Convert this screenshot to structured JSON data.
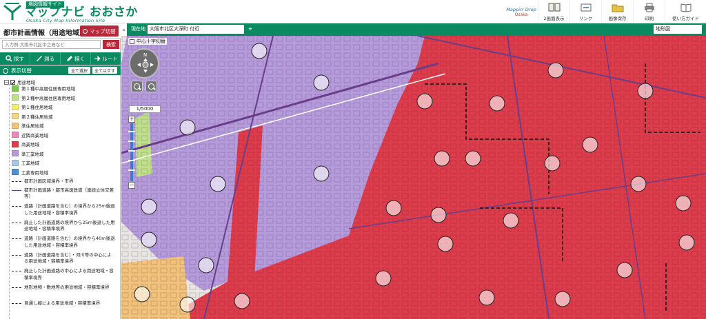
{
  "header": {
    "site_type": "地図情報サイト",
    "title": "マップナビ おおさか",
    "subtitle": "Osaka City Map Information Site",
    "mapdrop_line1": "Mappin' Drop",
    "mapdrop_line2": "Osaka",
    "tools": [
      {
        "label": "2画面表示"
      },
      {
        "label": "リンク"
      },
      {
        "label": "画像保存"
      },
      {
        "label": "印刷"
      },
      {
        "label": "使い方ガイド"
      }
    ]
  },
  "panel": {
    "title": "都市計画情報（用途地域）",
    "switch_label": "マップ切替",
    "search_placeholder": "入力例:大阪市北区中之島など",
    "search_button": "検索",
    "nav": [
      {
        "label": "探す"
      },
      {
        "label": "測る"
      },
      {
        "label": "描く"
      },
      {
        "label": "ルート"
      }
    ],
    "display_label": "表示切替",
    "select_all": "全て選択",
    "clear_all": "全てはずす",
    "legend_root": "用途地域",
    "legend": [
      {
        "label": "第１種中高層住居専用地域",
        "color": "#7ec850"
      },
      {
        "label": "第２種中高層住居専用地域",
        "color": "#bfe08a"
      },
      {
        "label": "第１種住居地域",
        "color": "#f4ef6a"
      },
      {
        "label": "第２種住居地域",
        "color": "#f6d58a"
      },
      {
        "label": "準住居地域",
        "color": "#f2c27a"
      },
      {
        "label": "近隣商業地域",
        "color": "#ec86b8"
      },
      {
        "label": "商業地域",
        "color": "#de3c4a"
      },
      {
        "label": "準工業地域",
        "color": "#b59bdc"
      },
      {
        "label": "工業地域",
        "color": "#a8c8e4"
      },
      {
        "label": "工業専用地域",
        "color": "#4a90d9"
      }
    ],
    "lines": [
      {
        "label": "都市計画区域境界・市界"
      },
      {
        "label": "都市計画道路・都市高速鉄道（連続立体交差等）"
      },
      {
        "label": "道路（計画道路を含む）の境界から25m後退した用途地域・容積率境界"
      },
      {
        "label": "廃止した計画道路の境界から25m後退した用途地域・容積率境界"
      },
      {
        "label": "道路（計画道路を含む）の境界から40m後退した用途地域・容積率境界"
      },
      {
        "label": "道路（計画道路を含む）・河川等の中心による用途地域・容積率境界"
      },
      {
        "label": "廃止した計画道路の中心による用途地域・容積率境界"
      },
      {
        "label": "地形地物・敷地等の用途地域・容積率境界"
      },
      {
        "label": "見通し線による用途地域・容積率境界"
      }
    ]
  },
  "mapbar": {
    "location_label": "現在地",
    "location_value": "大阪市北区大深町 付近",
    "basemap": "地形図"
  },
  "map": {
    "cross_label": "中心十字切替",
    "scale": "1/5000",
    "zoom_in": "+",
    "zoom_out": "−",
    "compass_north": "N"
  }
}
